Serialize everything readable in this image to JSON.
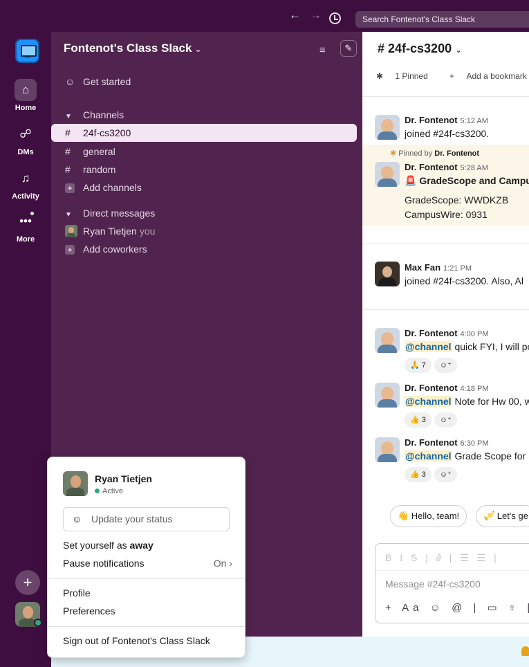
{
  "topbar": {
    "back_icon": "←",
    "forward_icon": "→",
    "search_placeholder": "Search Fontenot's Class Slack"
  },
  "rail": {
    "items": [
      {
        "label": "Home",
        "icon": "⌂"
      },
      {
        "label": "DMs",
        "icon": "☍"
      },
      {
        "label": "Activity",
        "icon": "♫"
      },
      {
        "label": "More",
        "icon": "•••"
      }
    ],
    "add_icon": "+"
  },
  "sidebar": {
    "workspace_name": "Fontenot's Class Slack",
    "chev": "⌄",
    "get_started": "Get started",
    "channels_header": "Channels",
    "channels": [
      "24f-cs3200",
      "general",
      "random"
    ],
    "add_channels": "Add channels",
    "dm_header": "Direct messages",
    "dm_user": "Ryan Tietjen",
    "dm_you": "you",
    "add_coworkers": "Add coworkers"
  },
  "main": {
    "channel_title": "# 24f-cs3200",
    "pinned_count": "1 Pinned",
    "add_bookmark": "Add a bookmark",
    "pinned_by_prefix": "Pinned by",
    "pinned_by_name": "Dr. Fontenot",
    "messages": [
      {
        "name": "Dr. Fontenot",
        "time": "5:12 AM",
        "text": "joined #24f-cs3200."
      },
      {
        "name": "Dr. Fontenot",
        "time": "5:28 AM",
        "title": "GradeScope and Campus",
        "line1": "GradeScope: WWDKZB",
        "line2": "CampusWire: 0931"
      },
      {
        "name": "Max Fan",
        "time": "1:21 PM",
        "text": "joined #24f-cs3200. Also, Al"
      },
      {
        "name": "Dr. Fontenot",
        "time": "4:00 PM",
        "mention": "@channel",
        "text": "quick FYI, I will po",
        "reaction": "🙏",
        "count": "7"
      },
      {
        "name": "Dr. Fontenot",
        "time": "4:18 PM",
        "mention": "@channel",
        "text": "Note for Hw 00, w",
        "reaction": "👍",
        "count": "3"
      },
      {
        "name": "Dr. Fontenot",
        "time": "6:30 PM",
        "mention": "@channel",
        "text": "Grade Scope for N",
        "reaction": "👍",
        "count": "3"
      }
    ],
    "chips": [
      "👋 Hello, team!",
      "🎺 Let's ge"
    ],
    "composer_placeholder": "Message #24f-cs3200",
    "format_icons": "B I S | ∂ | ☰ ☰ |",
    "tool_icons": "+ Aa ☺ @ | ▭ ♀ | ["
  },
  "popover": {
    "name": "Ryan Tietjen",
    "presence": "Active",
    "status_placeholder": "Update your status",
    "set_away_prefix": "Set yourself as",
    "set_away_bold": "away",
    "pause_notifications": "Pause notifications",
    "pause_state": "On ›",
    "profile": "Profile",
    "preferences": "Preferences",
    "sign_out": "Sign out of Fontenot's Class Slack"
  },
  "colors": {
    "rail_bg": "#3f0e40",
    "sidebar_bg": "#51244f",
    "selected_channel_bg": "#f3e5f3",
    "mention_bg": "#fdf0c8",
    "active_green": "#2bac76"
  }
}
